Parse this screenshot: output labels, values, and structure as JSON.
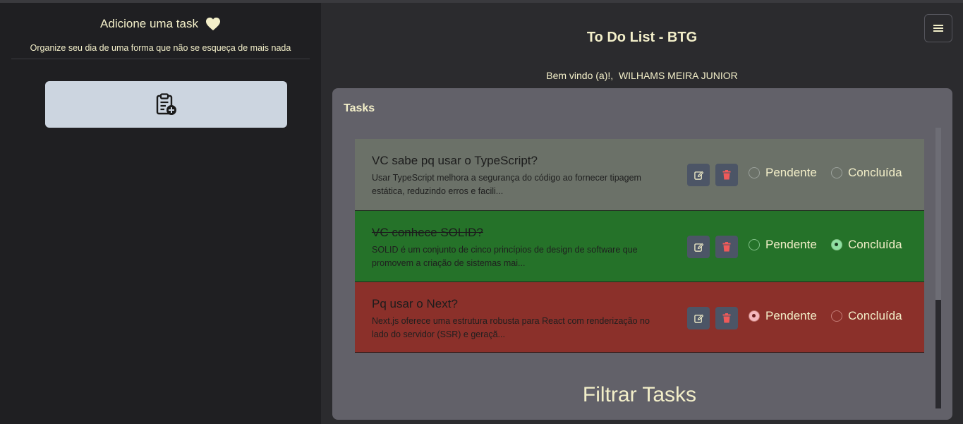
{
  "sidebar": {
    "title": "Adicione uma task",
    "heart_icon": "heart-icon",
    "subtitle": "Organize seu dia de uma forma que não se esqueça de mais nada",
    "add_button_icon": "clipboard-plus-icon"
  },
  "header": {
    "title": "To Do List - BTG",
    "welcome_prefix": "Bem vindo (a)!,",
    "user_name": "WILHAMS MEIRA JUNIOR",
    "menu_icon": "hamburger-menu-icon"
  },
  "tasks_panel": {
    "title": "Tasks",
    "status_labels": {
      "pending": "Pendente",
      "done": "Concluída"
    },
    "items": [
      {
        "title": "VC sabe pq usar o TypeScript?",
        "description": "Usar TypeScript melhora a segurança do código ao fornecer tipagem estática, reduzindo erros e facili...",
        "status": "none"
      },
      {
        "title": "VC conhece SOLID?",
        "description": "SOLID é um conjunto de cinco princípios de design de software que promovem a criação de sistemas mai...",
        "status": "done"
      },
      {
        "title": "Pq usar o Next?",
        "description": "Next.js oferece uma estrutura robusta para React com renderização no lado do servidor (SSR) e geraçã...",
        "status": "pending"
      }
    ]
  },
  "filter": {
    "title": "Filtrar Tasks"
  },
  "colors": {
    "accent_text": "#f3efc9",
    "task_neutral": "#6b7168",
    "task_done": "#257229",
    "task_pending": "#8b302a",
    "button_bg": "#4c5566"
  }
}
